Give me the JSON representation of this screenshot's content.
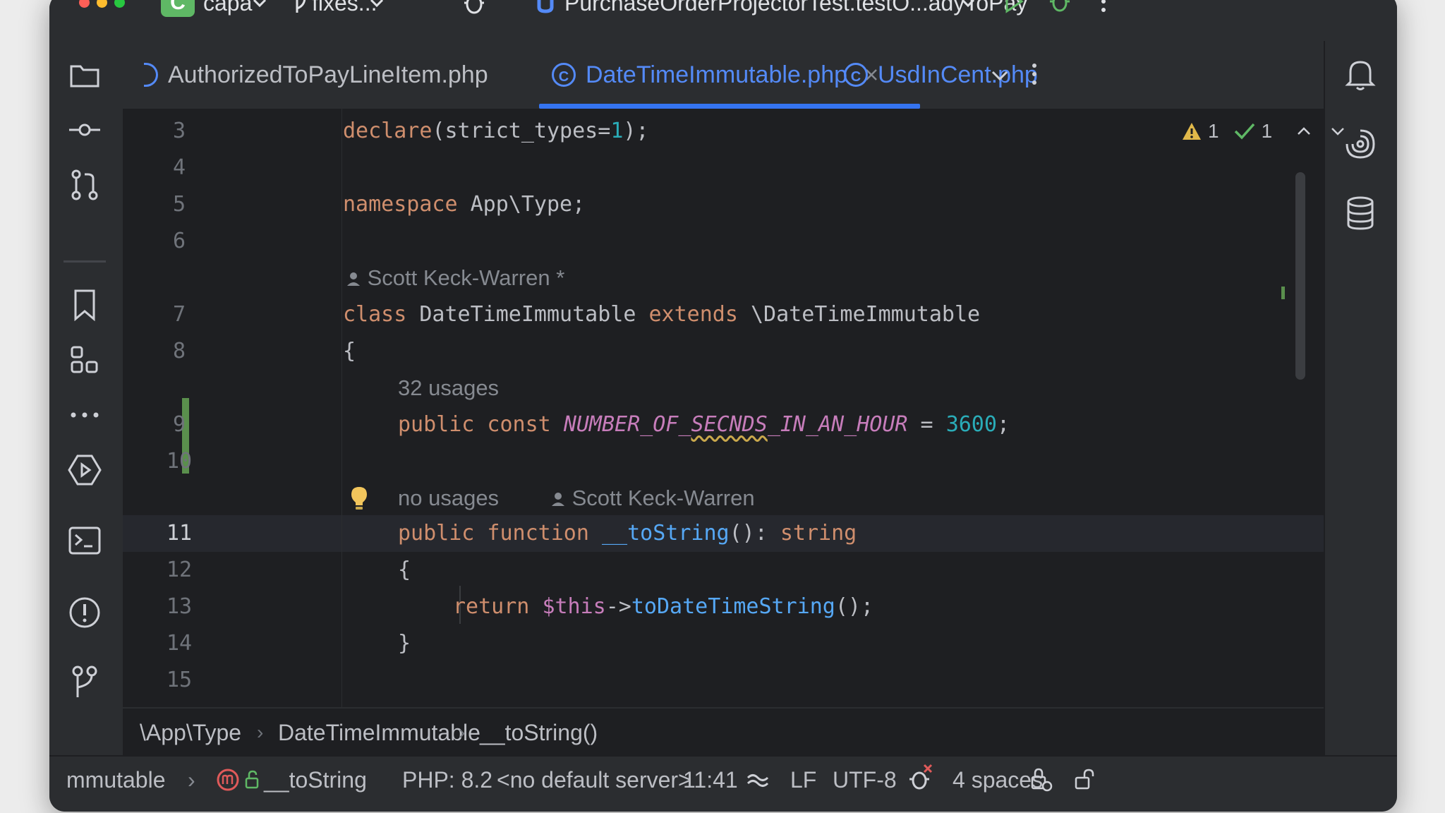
{
  "titlebar": {
    "project_badge": "C",
    "project_name": "capa",
    "branch": "fixes...",
    "run_config": "PurchaseOrderProjectorTest.testO...adyToPay"
  },
  "tabs": [
    {
      "label": "AuthorizedToPayLineItem.php",
      "active": false
    },
    {
      "label": "DateTimeImmutable.php",
      "active": true
    },
    {
      "label": "UsdInCent.php",
      "active": false
    }
  ],
  "inspections": {
    "warnings": "1",
    "ok": "1"
  },
  "editor": {
    "line_numbers": [
      "3",
      "4",
      "5",
      "6",
      "7",
      "8",
      "9",
      "10",
      "11",
      "12",
      "13",
      "14",
      "15"
    ],
    "code": {
      "declare_fn": "declare",
      "declare_open": "(strict_types=",
      "declare_num": "1",
      "declare_close": ");",
      "ns_kw": "namespace",
      "ns_name": " App\\Type;",
      "class_author": "Scott Keck-Warren *",
      "class_kw": "class",
      "class_name": " DateTimeImmutable ",
      "extends_kw": "extends",
      "parent_name": " \\DateTimeImmutable",
      "open_brace": "{",
      "const_usages": "32 usages",
      "const_mods": "public const ",
      "const_name_a": "NUMBER_OF_",
      "const_name_b": "SECNDS",
      "const_name_c": "_IN_AN_HOUR",
      "const_eq": " = ",
      "const_val": "3600",
      "semicolon": ";",
      "fn_usages": "no usages",
      "fn_author": "Scott Keck-Warren",
      "fn_mods": "public function ",
      "fn_name": "__toString",
      "fn_parens": "(): ",
      "fn_return": "string",
      "fn_open": "{",
      "return_kw": "return ",
      "this_var": "$this",
      "arrow": "->",
      "method_call": "toDateTimeString",
      "call_end": "();",
      "fn_close": "}"
    }
  },
  "breadcrumb": [
    "\\App\\Type",
    "DateTimeImmutable",
    "__toString()"
  ],
  "status": {
    "path_tail": "mmutable",
    "method": "__toString",
    "php_version": "PHP: 8.2",
    "server": "<no default server>",
    "caret": "11:41",
    "line_sep": "LF",
    "encoding": "UTF-8",
    "indent": "4 spaces"
  }
}
